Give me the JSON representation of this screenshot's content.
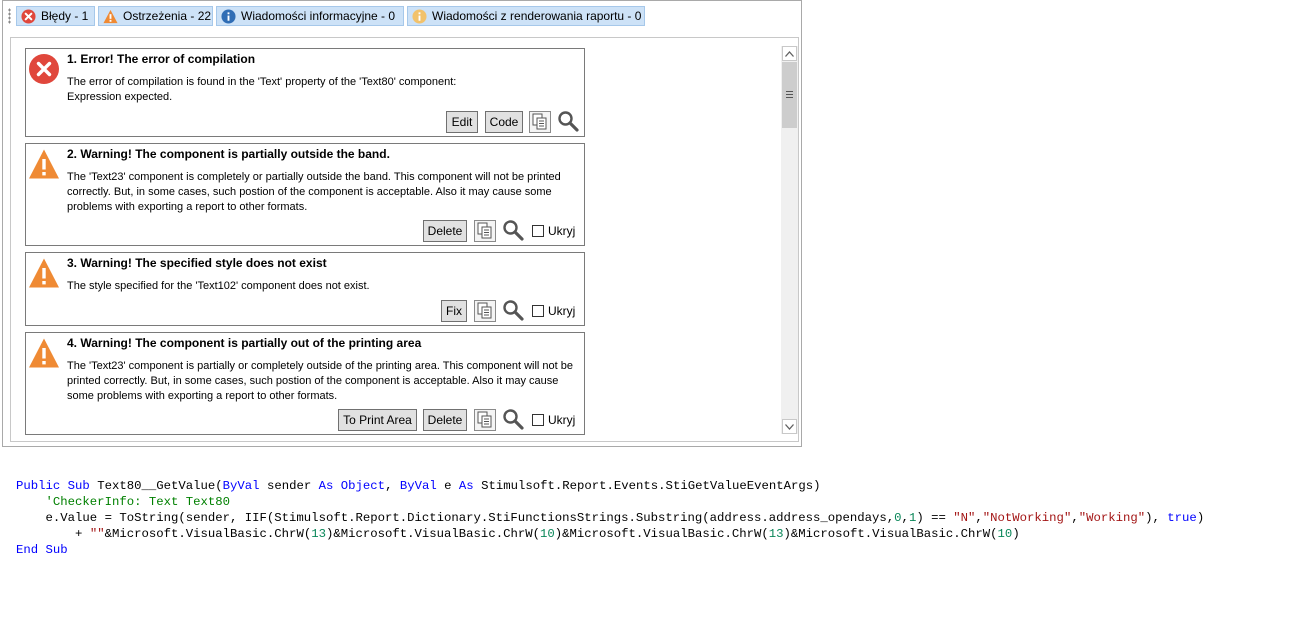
{
  "tabs": [
    {
      "label": "Błędy - 1",
      "icon": "error-icon"
    },
    {
      "label": "Ostrzeżenia - 22",
      "icon": "warning-icon"
    },
    {
      "label": "Wiadomości informacyjne - 0",
      "icon": "info-icon"
    },
    {
      "label": "Wiadomości z renderowania raportu - 0",
      "icon": "render-info-icon"
    }
  ],
  "messages": [
    {
      "title": "1. Error! The error of compilation",
      "description": "The error of compilation is found in the 'Text' property of the 'Text80' component:\nExpression expected.",
      "icon": "error-icon",
      "buttons": [
        "Edit",
        "Code"
      ]
    },
    {
      "title": "2. Warning! The component is partially outside the band.",
      "description": "The 'Text23' component is completely or partially outside the band. This component will not be printed correctly. But, in some cases, such postion of the component is acceptable. Also it may cause some problems with exporting a report to other formats.",
      "icon": "warning-icon",
      "buttons": [
        "Delete"
      ],
      "hide_label": "Ukryj"
    },
    {
      "title": "3. Warning! The specified style does not exist",
      "description": "The style specified for the 'Text102' component does not exist.",
      "icon": "warning-icon",
      "buttons": [
        "Fix"
      ],
      "hide_label": "Ukryj"
    },
    {
      "title": "4. Warning! The component is partially out of the printing area",
      "description": "The 'Text23' component is partially or completely outside of the printing area. This component will not be printed correctly. But, in some cases, such postion of the component is acceptable. Also it may cause some problems with exporting a report to other formats.",
      "icon": "warning-icon",
      "buttons": [
        "To Print Area",
        "Delete"
      ],
      "hide_label": "Ukryj"
    }
  ],
  "code": {
    "line1": {
      "kw_public": "Public",
      "kw_sub": "Sub",
      "name": "Text80__GetValue(",
      "kw_byval1": "ByVal",
      "sender": "sender",
      "kw_as1": "As",
      "kw_object": "Object",
      "comma": ",",
      "kw_byval2": "ByVal",
      "e": "e",
      "kw_as2": "As",
      "type": "Stimulsoft.Report.Events.StiGetValueEventArgs)"
    },
    "line2_comment": "'CheckerInfo: Text Text80",
    "line3": {
      "a": "e.Value = ToString(sender, IIF(Stimulsoft.Report.Dictionary.StiFunctionsStrings.Substring(address.address_opendays,",
      "n0": "0",
      "c1": ",",
      "n1": "1",
      "b": ") == ",
      "s_n": "\"N\"",
      "c2": ",",
      "s_nw": "\"NotWorking\"",
      "c3": ",",
      "s_w": "\"Working\"",
      "c4": "), ",
      "kw_true": "true",
      "end": ")"
    },
    "line4": {
      "plus": "+ ",
      "empty": "\"\"",
      "p1": "&Microsoft.VisualBasic.ChrW(",
      "n13a": "13",
      "p2": ")&Microsoft.VisualBasic.ChrW(",
      "n10a": "10",
      "p3": ")&Microsoft.VisualBasic.ChrW(",
      "n13b": "13",
      "p4": ")&Microsoft.VisualBasic.ChrW(",
      "n10b": "10",
      "p5": ")"
    },
    "line5": {
      "kw_end": "End",
      "kw_sub": "Sub"
    }
  },
  "colors": {
    "tab_bg": "#cde2f7",
    "error": "#e0473c",
    "warning": "#ef8a34",
    "info": "#2f6db5",
    "keyword": "#0000ff",
    "comment": "#008000",
    "string": "#a31515"
  }
}
